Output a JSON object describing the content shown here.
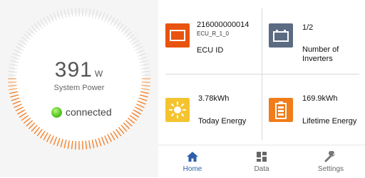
{
  "power": {
    "value": "391",
    "unit": "W",
    "label": "System Power"
  },
  "status": {
    "text": "connected"
  },
  "tiles": {
    "ecu": {
      "primary": "216000000014",
      "secondary": "ECU_R_1_0",
      "label": "ECU ID",
      "icon_color": "#e8530e"
    },
    "inverters": {
      "primary": "1/2",
      "label_line1": "Number of",
      "label_line2": "Inverters",
      "icon_color": "#5b6b82"
    },
    "today": {
      "primary": "3.78kWh",
      "label": "Today Energy",
      "icon_color": "#f4c430"
    },
    "lifetime": {
      "primary": "169.9kWh",
      "label": "Lifetime Energy",
      "icon_color": "#f07c1a"
    }
  },
  "nav": [
    {
      "label": "Home",
      "icon": "home-icon",
      "active": true
    },
    {
      "label": "Data",
      "icon": "grid-icon",
      "active": false
    },
    {
      "label": "Settings",
      "icon": "wrench-icon",
      "active": false
    }
  ],
  "colors": {
    "accent": "#2b5fa8",
    "inactive": "#666666",
    "gauge_orange": "#f47b20"
  }
}
